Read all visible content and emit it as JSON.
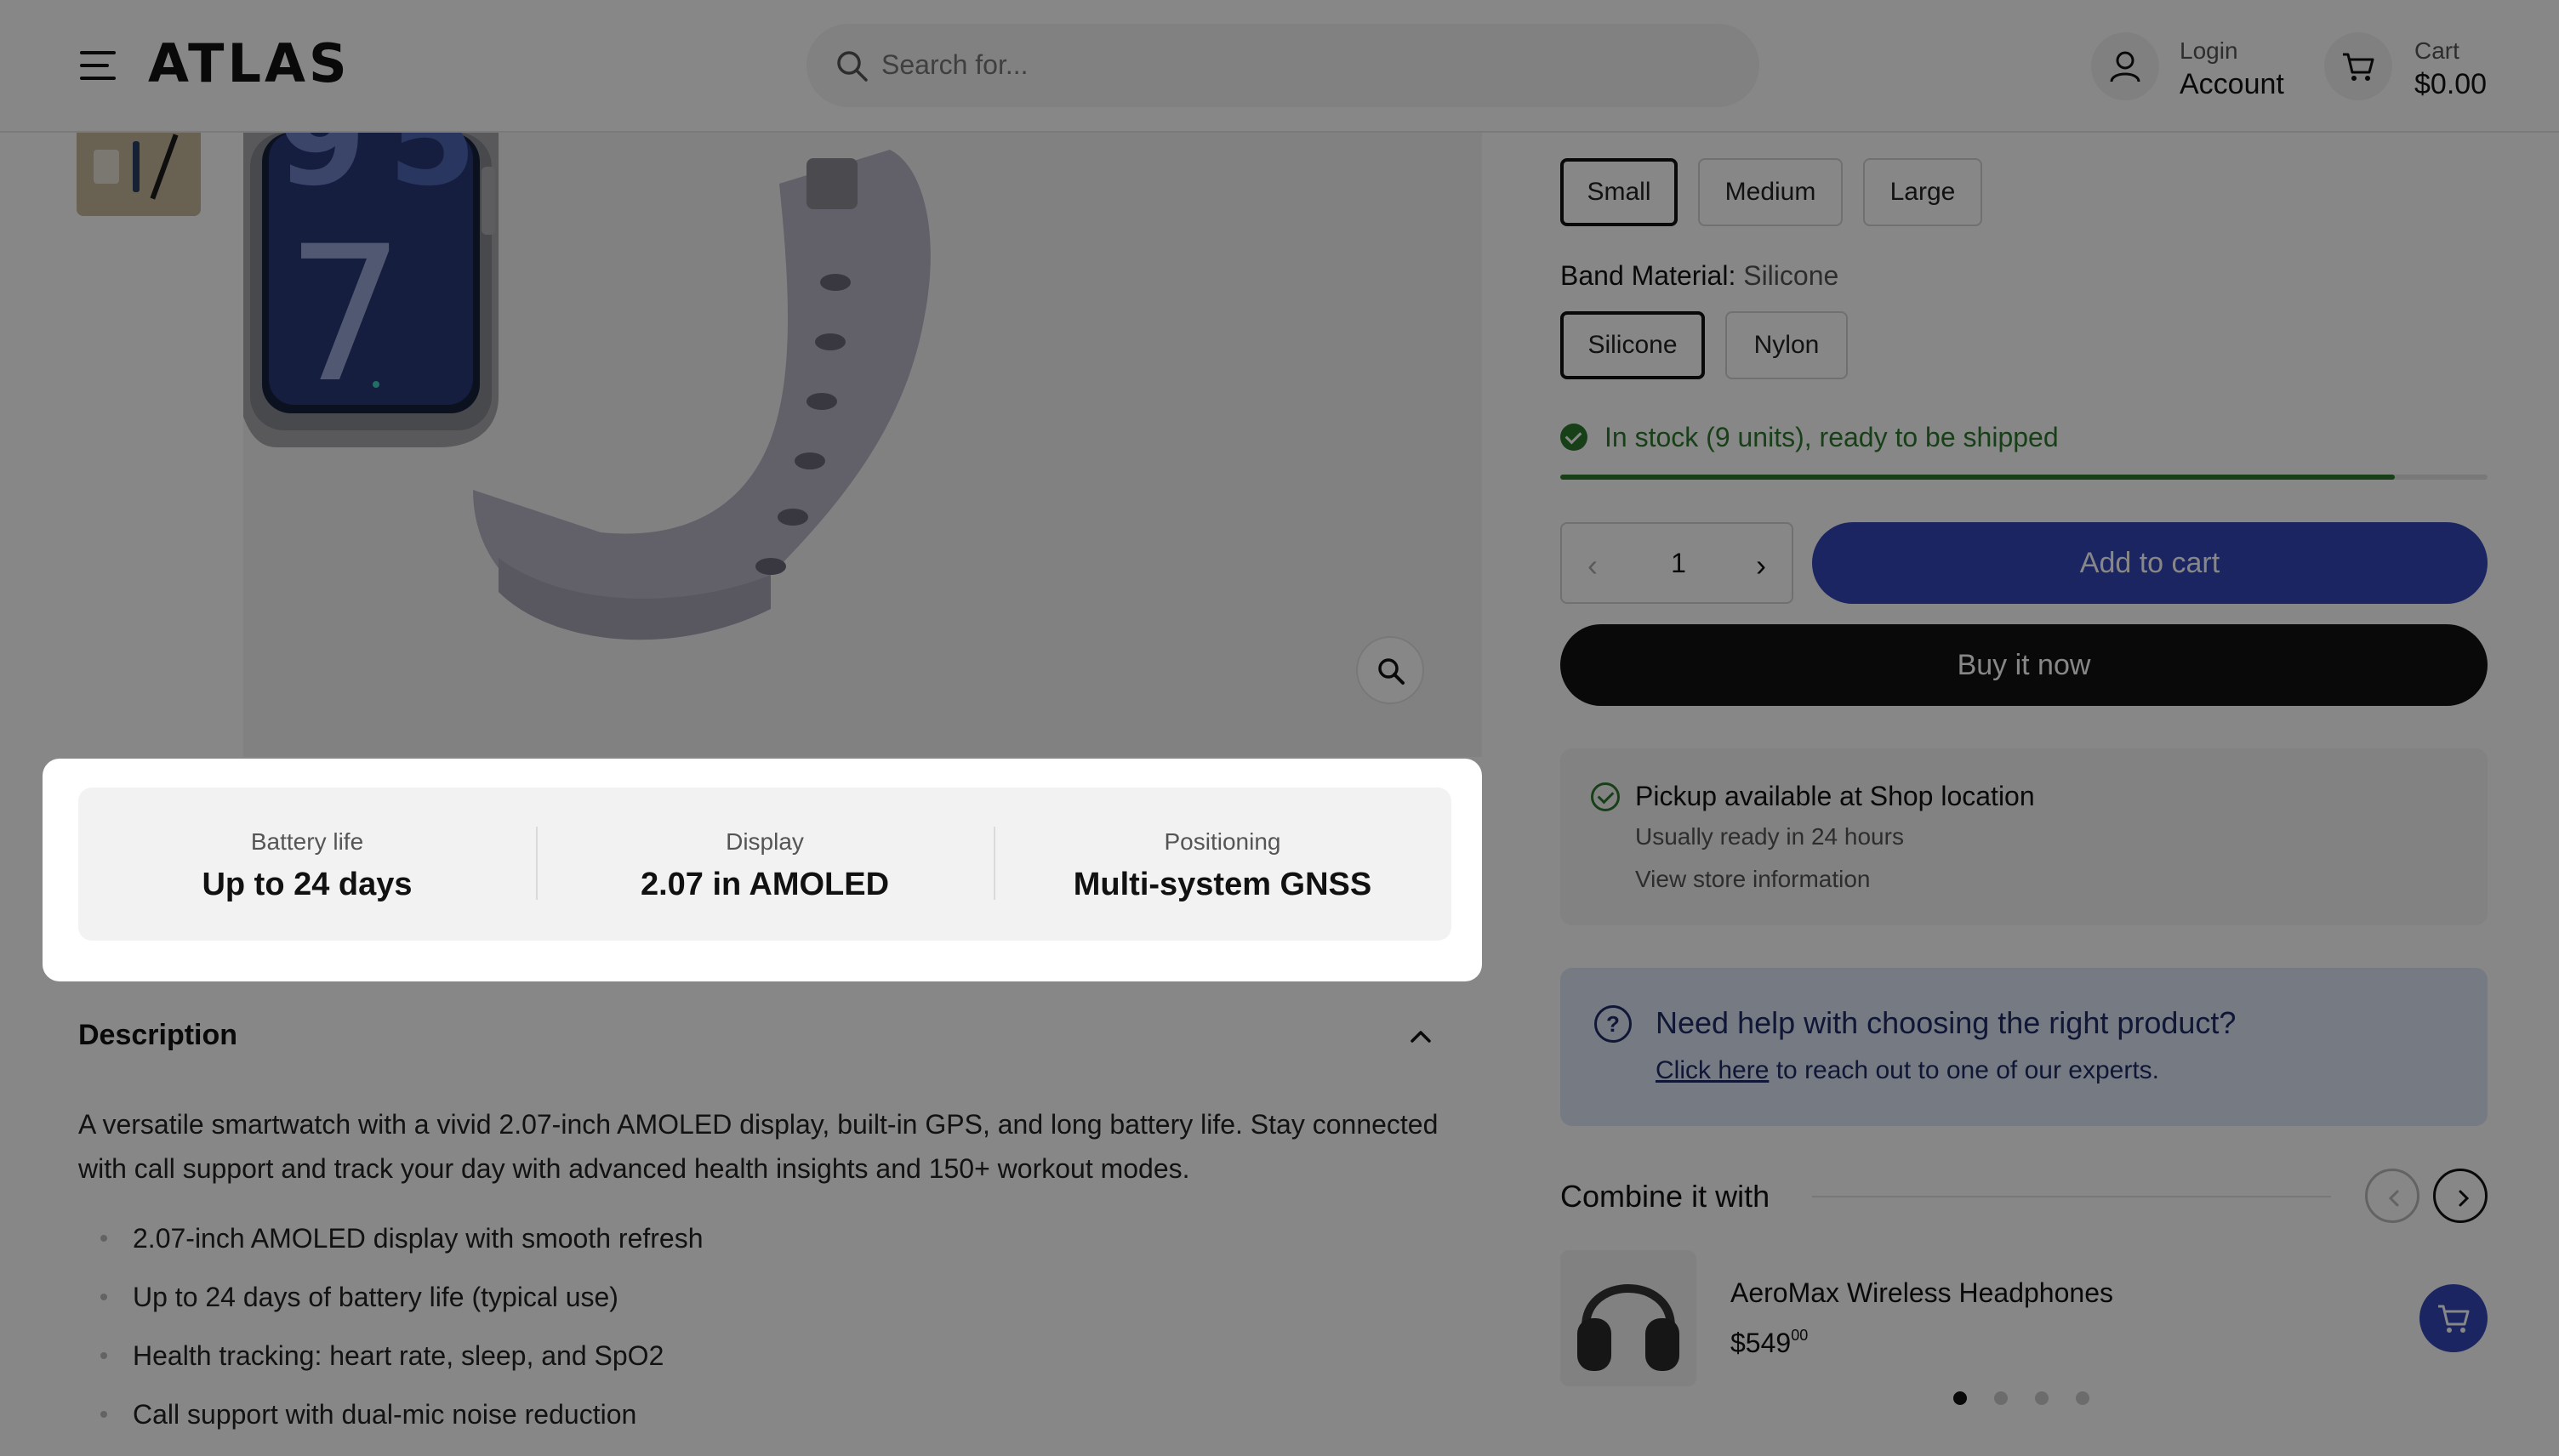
{
  "header": {
    "logo": "ATLAS",
    "search_placeholder": "Search for...",
    "account": {
      "small": "Login",
      "big": "Account"
    },
    "cart": {
      "small": "Cart",
      "big": "$0.00"
    }
  },
  "specs": [
    {
      "label": "Battery life",
      "value": "Up to 24 days"
    },
    {
      "label": "Display",
      "value": "2.07 in AMOLED"
    },
    {
      "label": "Positioning",
      "value": "Multi-system GNSS"
    }
  ],
  "description": {
    "title": "Description",
    "text": "A versatile smartwatch with a vivid 2.07-inch AMOLED display, built-in GPS, and long battery life. Stay connected with call support and track your day with advanced health insights and 150+ workout modes.",
    "bullets": [
      "2.07-inch AMOLED display with smooth refresh",
      "Up to 24 days of battery life (typical use)",
      "Health tracking: heart rate, sleep, and SpO2",
      "Call support with dual-mic noise reduction"
    ]
  },
  "options": {
    "sizes": [
      "Small",
      "Medium",
      "Large"
    ],
    "selected_size": "Small",
    "band_label": "Band Material:",
    "band_value": "Silicone",
    "bands": [
      "Silicone",
      "Nylon"
    ]
  },
  "stock": {
    "text": "In stock (9 units), ready to be shipped",
    "level": 0.9,
    "color": "#2f7a2f"
  },
  "purchase": {
    "quantity": "1",
    "add_to_cart": "Add to cart",
    "buy_now": "Buy it now",
    "accent": "#3346b7"
  },
  "pickup": {
    "title": "Pickup available at Shop location",
    "subtitle": "Usually ready in 24 hours",
    "link": "View store information"
  },
  "help": {
    "title": "Need help with choosing the right product?",
    "link": "Click here",
    "rest": " to reach out to one of our experts."
  },
  "combine": {
    "title": "Combine it with",
    "product_name": "AeroMax Wireless Headphones",
    "price_main": "$549",
    "price_cents": "00",
    "dots": 4,
    "active_dot": 0
  }
}
